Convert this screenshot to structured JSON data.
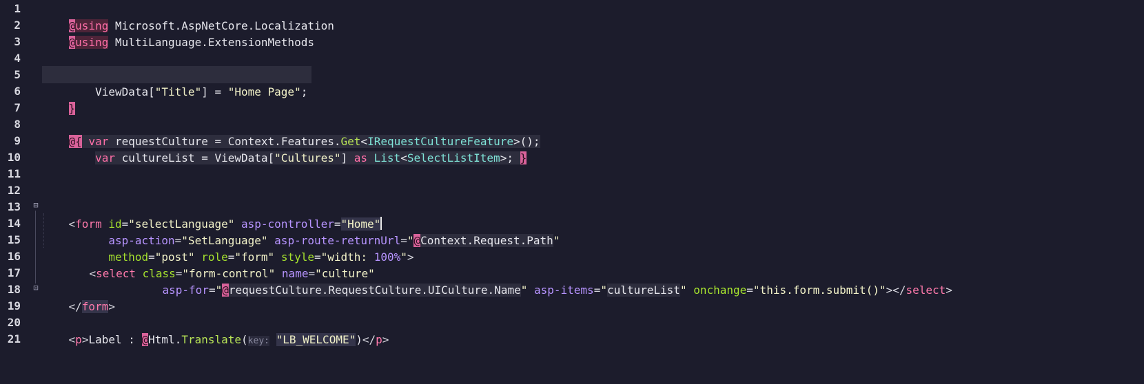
{
  "editor": {
    "line_numbers": [
      "1",
      "2",
      "3",
      "4",
      "5",
      "6",
      "7",
      "8",
      "9",
      "10",
      "11",
      "12",
      "13",
      "14",
      "15",
      "16",
      "17",
      "18",
      "19",
      "20",
      "21"
    ],
    "fold_icons": {
      "open": "⊟",
      "close": "⊡"
    },
    "lines": {
      "l1": [
        "@",
        "using",
        " Microsoft.AspNetCore.Localization"
      ],
      "l2": [
        "@",
        "using",
        " MultiLanguage.ExtensionMethods"
      ],
      "l4": [
        "@",
        "{"
      ],
      "l5": [
        "    ",
        "ViewData[",
        "\"Title\"",
        "] = ",
        "\"Home Page\"",
        ";"
      ],
      "l6": [
        "}"
      ],
      "l8": [
        "@",
        "{",
        " ",
        "var",
        " requestCulture = Context.Features.",
        "Get",
        "<",
        "IRequestCultureFeature",
        ">();"
      ],
      "l9": [
        "    ",
        "var",
        " cultureList = ViewData[",
        "\"Cultures\"",
        "] ",
        "as",
        " ",
        "List",
        "<",
        "SelectListItem",
        ">; ",
        "}"
      ],
      "l13": [
        "<",
        "form",
        " ",
        "id",
        "=",
        "\"selectLanguage\"",
        " ",
        "asp-controller",
        "=",
        "\"Home\""
      ],
      "l14": [
        "      ",
        "asp-action",
        "=",
        "\"SetLanguage\"",
        " ",
        "asp-route-returnUrl",
        "=",
        "\"",
        "@",
        "Context.Request.Path",
        "\""
      ],
      "l15": [
        "      ",
        "method",
        "=",
        "\"post\"",
        " ",
        "role",
        "=",
        "\"form\"",
        " ",
        "style",
        "=",
        "\"width: ",
        "100%",
        "\"",
        ">"
      ],
      "l16": [
        "  ",
        "<",
        "select",
        " ",
        "class",
        "=",
        "\"form-control\"",
        " ",
        "name",
        "=",
        "\"culture\""
      ],
      "l17": [
        "           ",
        "asp-for",
        "=",
        "\"",
        "@",
        "requestCulture.RequestCulture.UICulture.Name",
        "\"",
        " ",
        "asp-items",
        "=",
        "\"",
        "cultureList",
        "\"",
        " ",
        "onchange",
        "=",
        "\"this.form.submit()\"",
        "></",
        "select",
        ">"
      ],
      "l18": [
        "</",
        "form",
        ">"
      ],
      "l20": [
        "<",
        "p",
        ">",
        "Label : ",
        "@",
        "Html.",
        "Translate",
        "(",
        "key:",
        " ",
        "\"LB_WELCOME\"",
        ")",
        "</",
        "p",
        ">"
      ]
    }
  }
}
